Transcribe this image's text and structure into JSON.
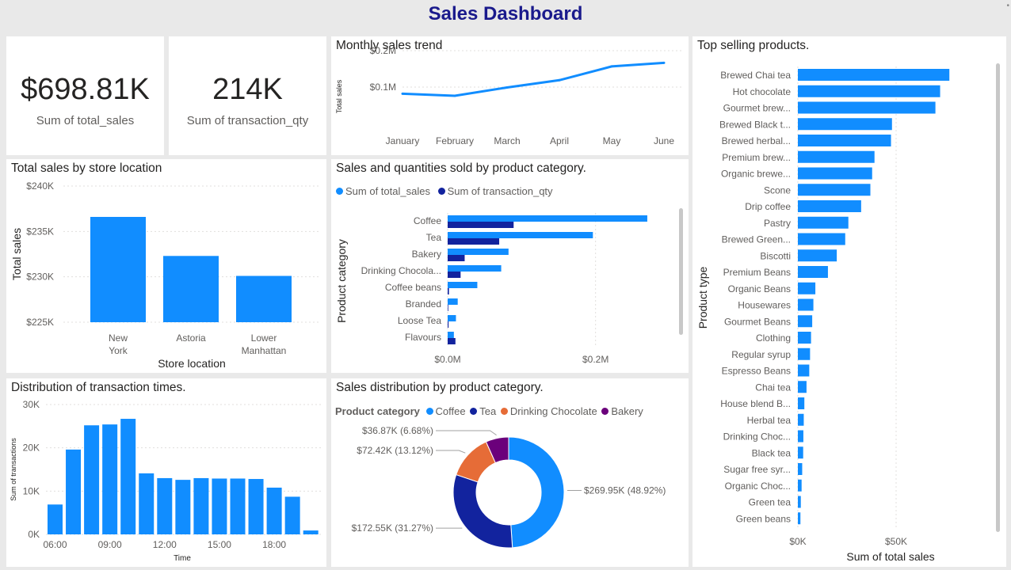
{
  "dashboard": {
    "title": "Sales Dashboard"
  },
  "kpis": [
    {
      "value": "$698.81K",
      "label": "Sum of total_sales"
    },
    {
      "value": "214K",
      "label": "Sum of transaction_qty"
    }
  ],
  "colors": {
    "primary": "#118dff",
    "dark": "#12239e",
    "orange": "#e66c37",
    "purple": "#6b007b",
    "title": "#1a1a8c"
  },
  "chart_data": [
    {
      "id": "monthly",
      "type": "line",
      "title": "Monthly sales trend",
      "xlabel": "",
      "ylabel": "Total sales",
      "categories": [
        "January",
        "February",
        "March",
        "April",
        "May",
        "June"
      ],
      "values": [
        81678,
        76145,
        98835,
        118941,
        156728,
        166486
      ],
      "ylim": [
        0,
        200000
      ],
      "ytick_labels": [
        "$0.1M",
        "$0.2M"
      ],
      "grid": true
    },
    {
      "id": "store",
      "type": "bar",
      "title": "Total sales by store location",
      "xlabel": "Store location",
      "ylabel": "Total sales",
      "categories": [
        "New York",
        "Astoria",
        "Lower Manhattan"
      ],
      "values": [
        236600,
        232300,
        230100
      ],
      "ylim": [
        225000,
        240000
      ],
      "ytick_labels": [
        "$225K",
        "$230K",
        "$235K",
        "$240K"
      ],
      "grid": true
    },
    {
      "id": "category",
      "type": "bar",
      "title": "Sales and quantities sold by product category.",
      "xlabel": "",
      "ylabel": "Product category",
      "categories": [
        "Coffee",
        "Tea",
        "Bakery",
        "Drinking Chocola...",
        "Coffee beans",
        "Branded",
        "Loose Tea",
        "Flavours"
      ],
      "series": [
        {
          "name": "Sum of total_sales",
          "values": [
            269950,
            196400,
            82300,
            72400,
            40100,
            13600,
            11200,
            8400
          ]
        },
        {
          "name": "Sum of transaction_qty",
          "values": [
            89200,
            69700,
            23000,
            17500,
            1750,
            800,
            1200,
            10500
          ]
        }
      ],
      "xlim": [
        0,
        300000
      ],
      "xtick_labels": [
        "$0.0M",
        "$0.2M"
      ],
      "legend": "top-left",
      "grid": true
    },
    {
      "id": "times",
      "type": "bar",
      "title": "Distribution of transaction times.",
      "xlabel": "Time",
      "ylabel": "Sum of transactions",
      "categories": [
        "06:00",
        "07:00",
        "08:00",
        "09:00",
        "10:00",
        "11:00",
        "12:00",
        "13:00",
        "14:00",
        "15:00",
        "16:00",
        "17:00",
        "18:00",
        "19:00",
        "20:00"
      ],
      "xtick_labels": [
        "06:00",
        "09:00",
        "12:00",
        "15:00",
        "18:00"
      ],
      "values": [
        6900,
        19600,
        25200,
        25400,
        26700,
        14100,
        13000,
        12600,
        13000,
        12900,
        12900,
        12800,
        10800,
        8700,
        900
      ],
      "ylim": [
        0,
        30000
      ],
      "ytick_labels": [
        "0K",
        "10K",
        "20K",
        "30K"
      ],
      "grid": true
    },
    {
      "id": "donut",
      "type": "pie",
      "title": "Sales distribution by product category.",
      "legend_title": "Product category",
      "legend": "top-left",
      "categories": [
        "Coffee",
        "Tea",
        "Drinking Chocolate",
        "Bakery"
      ],
      "values": [
        269950,
        172550,
        72420,
        36870
      ],
      "labels": [
        "$269.95K (48.92%)",
        "$172.55K (31.27%)",
        "$72.42K (13.12%)",
        "$36.87K (6.68%)"
      ]
    },
    {
      "id": "products",
      "type": "bar",
      "title": "Top selling products.",
      "xlabel": "Sum of total sales",
      "ylabel": "Product type",
      "categories": [
        "Brewed Chai tea",
        "Hot chocolate",
        "Gourmet brew...",
        "Brewed Black t...",
        "Brewed herbal...",
        "Premium brew...",
        "Organic brewe...",
        "Scone",
        "Drip coffee",
        "Pastry",
        "Brewed Green...",
        "Biscotti",
        "Premium Beans",
        "Organic Beans",
        "Housewares",
        "Gourmet Beans",
        "Clothing",
        "Regular syrup",
        "Espresso Beans",
        "Chai tea",
        "House blend B...",
        "Herbal tea",
        "Drinking Choc...",
        "Black tea",
        "Sugar free syr...",
        "Organic Choc...",
        "Green tea",
        "Green beans"
      ],
      "values": [
        77100,
        72400,
        70000,
        47900,
        47400,
        39000,
        37800,
        36900,
        32200,
        25700,
        24100,
        19800,
        15300,
        8900,
        7900,
        7300,
        6700,
        6200,
        5800,
        4400,
        3300,
        3000,
        2800,
        2700,
        2200,
        1900,
        1500,
        1300
      ],
      "xlim": [
        0,
        100000
      ],
      "xtick_labels": [
        "$0K",
        "$50K"
      ],
      "grid": true
    }
  ]
}
